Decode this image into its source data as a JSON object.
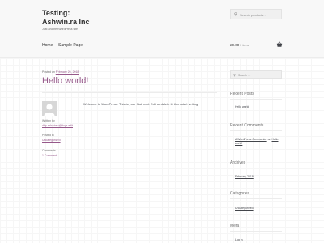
{
  "site": {
    "title_line1": "Testing:",
    "title_line2": "Ashwin.ra Inc",
    "description": "Just another WordPress site"
  },
  "header_search": {
    "placeholder": "Search products…",
    "icon": "search-icon"
  },
  "nav": {
    "home": "Home",
    "sample_page": "Sample Page"
  },
  "cart": {
    "total": "£0.00",
    "items": "0 items",
    "icon": "basket-icon"
  },
  "post": {
    "posted_prefix": "Posted on",
    "date": "February 26, 2018",
    "title": "Hello world!",
    "content": "Welcome to WordPress. This is your first post. Edit or delete it, then start writing!",
    "written_by_label": "Written by",
    "author": "dkp.ashwinra@dxyz.edit",
    "posted_in_label": "Posted in",
    "category": "Uncategorized",
    "comments_label": "Comments",
    "comments_link": "1 Comment"
  },
  "sidebar": {
    "search_placeholder": "Search …",
    "recent_posts": {
      "title": "Recent Posts",
      "items": [
        "Hello world!"
      ]
    },
    "recent_comments": {
      "title": "Recent Comments",
      "author": "A WordPress Commenter",
      "on": "on",
      "post": "Hello world!"
    },
    "archives": {
      "title": "Archives",
      "items": [
        "February 2018"
      ]
    },
    "categories": {
      "title": "Categories",
      "items": [
        "Uncategorized"
      ]
    },
    "meta": {
      "title": "Meta",
      "items": [
        "Log in"
      ]
    }
  },
  "colors": {
    "accent": "#96588a",
    "text": "#43454b",
    "header_bg": "#f8f8f8"
  }
}
